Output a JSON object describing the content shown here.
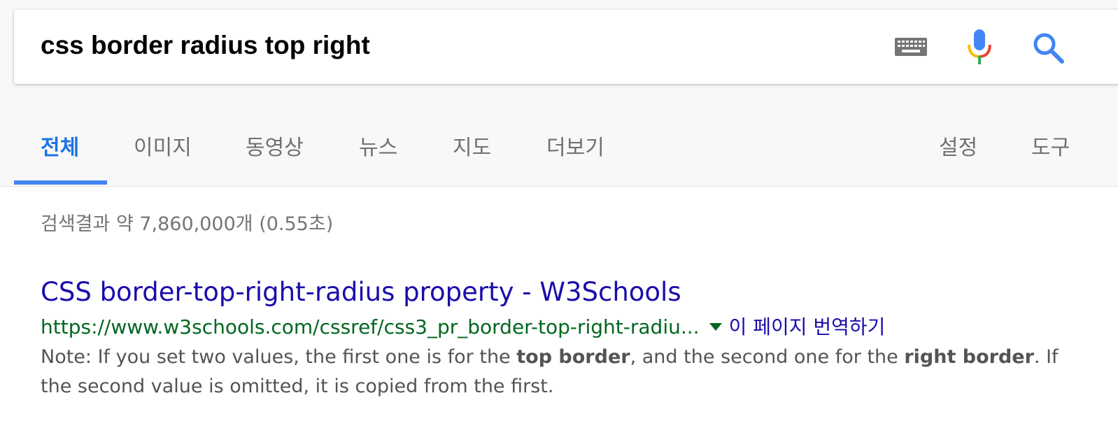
{
  "search": {
    "query": "css border radius top right",
    "keyboard_icon": "keyboard-icon",
    "mic_icon": "microphone-icon",
    "search_icon": "search-icon",
    "accent_color": "#4285f4"
  },
  "tabs": {
    "items": [
      {
        "label": "전체",
        "active": true
      },
      {
        "label": "이미지"
      },
      {
        "label": "동영상"
      },
      {
        "label": "뉴스"
      },
      {
        "label": "지도"
      },
      {
        "label": "더보기"
      }
    ],
    "settings_label": "설정",
    "tools_label": "도구"
  },
  "results": {
    "stats": "검색결과 약 7,860,000개 (0.55초)",
    "items": [
      {
        "title": "CSS border-top-right-radius property - W3Schools",
        "url": "https://www.w3schools.com/cssref/css3_pr_border-top-right-radiu...",
        "translate_label": "이 페이지 번역하기",
        "snippet": {
          "part1": "Note: If you set two values, the first one is for the ",
          "bold1": "top border",
          "part2": ", and the second one for the ",
          "bold2": "right border",
          "part3": ". If the second value is omitted, it is copied from the first."
        }
      }
    ]
  },
  "colors": {
    "title_link": "#1a0dab",
    "url_green": "#006621",
    "active_tab": "#1a73e8",
    "snippet_text": "#545454"
  }
}
